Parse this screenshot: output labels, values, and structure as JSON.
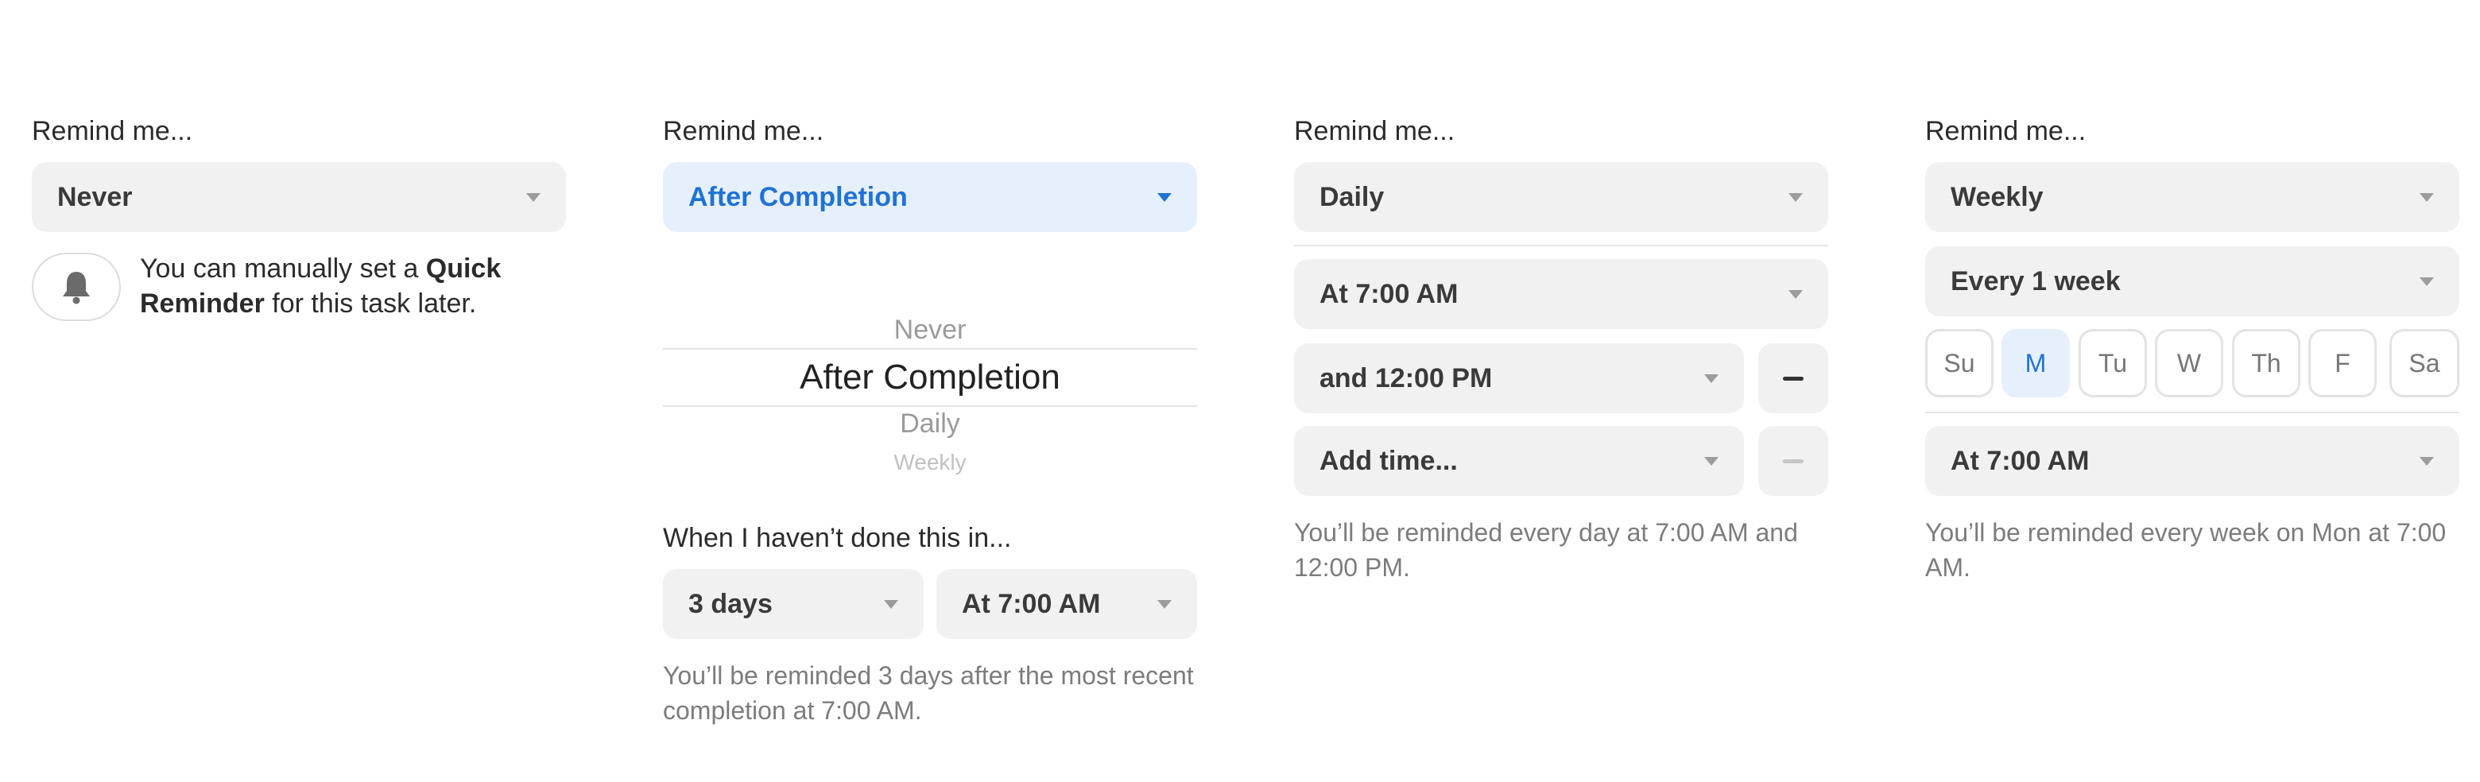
{
  "colors": {
    "accent": "#1f72d6",
    "accent_bg": "#e6f0fc",
    "field_bg": "#f1f1f1",
    "muted_text": "#7c7c7c"
  },
  "col1": {
    "label": "Remind me...",
    "select": "Never",
    "bell_icon": "bell-icon",
    "hint_pre": "You can manually set a ",
    "hint_bold1": "Quick",
    "hint_bold2": "Reminder",
    "hint_post": " for this task later."
  },
  "col2": {
    "label": "Remind me...",
    "select": "After Completion",
    "picker": [
      "Never",
      "After Completion",
      "Daily",
      "Weekly"
    ],
    "sub_label": "When I haven’t done this in...",
    "interval": "3 days",
    "time": "At 7:00 AM",
    "desc": "You’ll be reminded 3 days after the most recent completion at 7:00 AM."
  },
  "col3": {
    "label": "Remind me...",
    "select": "Daily",
    "times": [
      "At 7:00 AM",
      "and 12:00 PM",
      "Add time..."
    ],
    "desc": "You’ll be reminded every day at 7:00 AM and 12:00 PM."
  },
  "col4": {
    "label": "Remind me...",
    "select": "Weekly",
    "every": "Every 1 week",
    "days": [
      "Su",
      "M",
      "Tu",
      "W",
      "Th",
      "F",
      "Sa"
    ],
    "selected_day": "M",
    "time": "At 7:00 AM",
    "desc": "You’ll be reminded every week on Mon at 7:00 AM."
  }
}
